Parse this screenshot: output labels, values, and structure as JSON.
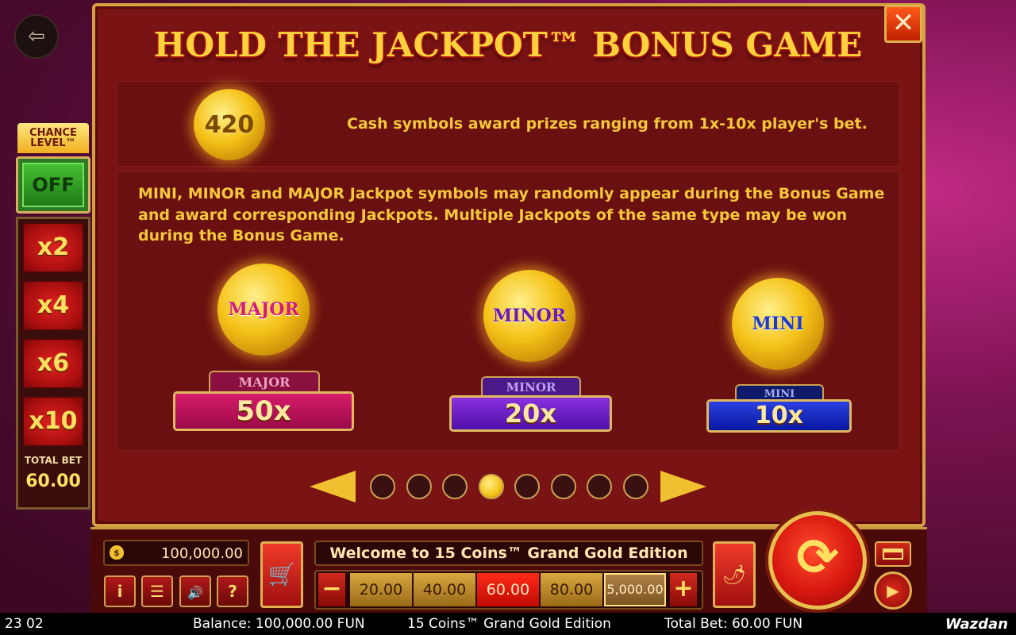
{
  "title": "HOLD THE JACKPOT™ BONUS GAME",
  "left_panel": {
    "chance_label": "CHANCE LEVEL™",
    "off_label": "OFF",
    "multipliers": [
      "x2",
      "x4",
      "x6",
      "x10"
    ],
    "total_bet_label": "TOTAL BET",
    "total_bet_value": "60.00"
  },
  "cash_section": {
    "coin_value": "420",
    "text": "Cash symbols award prizes ranging from 1x-10x player's bet."
  },
  "jackpot_section": {
    "text": "MINI, MINOR and MAJOR Jackpot symbols may randomly appear during the Bonus Game and award corresponding Jackpots. Multiple Jackpots of the same type may be won during the Bonus Game.",
    "jackpots": [
      {
        "coin_label": "MAJOR",
        "tag": "MAJOR",
        "value": "50x",
        "color": "#d81c6a"
      },
      {
        "coin_label": "MINOR",
        "tag": "MINOR",
        "value": "20x",
        "color": "#8a30e0"
      },
      {
        "coin_label": "MINI",
        "tag": "MINI",
        "value": "10x",
        "color": "#2a40e0"
      }
    ]
  },
  "pagination": {
    "total_pages": 8,
    "current_page": 4
  },
  "bottom_bar": {
    "balance": "100,000.00",
    "welcome": "Welcome to 15 Coins™ Grand Gold Edition",
    "bet_options": [
      "20.00",
      "40.00",
      "60.00",
      "80.00",
      "5,000.00"
    ],
    "selected_bet": "60.00",
    "minus": "−",
    "plus": "+",
    "small_buttons": {
      "info": "i",
      "menu": "☰",
      "sound": "🔊",
      "help": "?"
    }
  },
  "status_bar": {
    "time": "23 02",
    "balance": "Balance: 100,000.00 FUN",
    "game_name": "15 Coins™ Grand Gold Edition",
    "total_bet": "Total Bet: 60.00 FUN",
    "brand": "Wazdan"
  },
  "colors": {
    "panel_bg": "#7a1414",
    "gold": "#ffd23c",
    "text_gold": "#f5c83a"
  }
}
